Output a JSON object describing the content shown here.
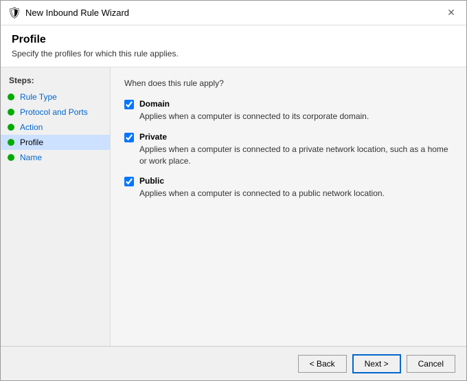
{
  "titleBar": {
    "icon": "🛡",
    "title": "New Inbound Rule Wizard",
    "closeLabel": "✕"
  },
  "header": {
    "title": "Profile",
    "subtitle": "Specify the profiles for which this rule applies."
  },
  "sidebar": {
    "stepsLabel": "Steps:",
    "items": [
      {
        "id": "rule-type",
        "label": "Rule Type",
        "active": false
      },
      {
        "id": "protocol-ports",
        "label": "Protocol and Ports",
        "active": false
      },
      {
        "id": "action",
        "label": "Action",
        "active": false
      },
      {
        "id": "profile",
        "label": "Profile",
        "active": true
      },
      {
        "id": "name",
        "label": "Name",
        "active": false
      }
    ]
  },
  "main": {
    "question": "When does this rule apply?",
    "options": [
      {
        "id": "domain",
        "label": "Domain",
        "checked": true,
        "description": "Applies when a computer is connected to its corporate domain."
      },
      {
        "id": "private",
        "label": "Private",
        "checked": true,
        "description": "Applies when a computer is connected to a private network location, such as a home or work place."
      },
      {
        "id": "public",
        "label": "Public",
        "checked": true,
        "description": "Applies when a computer is connected to a public network location."
      }
    ]
  },
  "footer": {
    "backLabel": "< Back",
    "nextLabel": "Next >",
    "cancelLabel": "Cancel"
  }
}
